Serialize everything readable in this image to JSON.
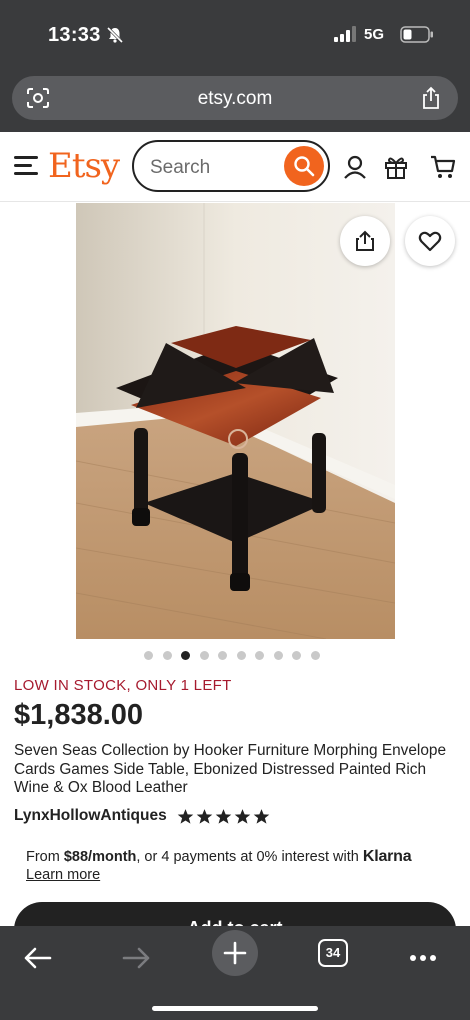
{
  "status_bar": {
    "time": "13:33",
    "network": "5G"
  },
  "browser": {
    "url": "etsy.com",
    "tab_count": "34"
  },
  "header": {
    "logo": "Etsy",
    "search_placeholder": "Search"
  },
  "product": {
    "stock_notice": "LOW IN STOCK, ONLY 1 LEFT",
    "price": "$1,838.00",
    "title": "Seven Seas Collection by Hooker Furniture Morphing Envelope Cards Games Side Table, Ebonized Distressed Painted Rich Wine & Ox Blood Leather",
    "seller": "LynxHollowAntiques",
    "rating_stars": 5,
    "image_count": 10,
    "active_image_index": 2
  },
  "financing": {
    "prefix": "From ",
    "monthly": "$88/month",
    "middle": ", or 4 payments at 0% interest with ",
    "provider": "Klarna",
    "learn_more": "Learn more"
  },
  "cta": {
    "label": "Add to cart"
  },
  "icons": {
    "notifications_muted": "bell-slash-icon",
    "lens": "lens-icon",
    "share": "share-icon",
    "menu": "hamburger-icon",
    "search": "search-icon",
    "account": "user-icon",
    "gift": "gift-icon",
    "cart": "cart-icon",
    "favorite": "heart-icon",
    "back": "arrow-left-icon",
    "forward": "arrow-right-icon",
    "new_tab": "plus-icon",
    "more": "more-icon"
  },
  "colors": {
    "brand": "#f1641e",
    "stock_alert": "#a61a2e",
    "browser_chrome": "#3a3b3d"
  }
}
